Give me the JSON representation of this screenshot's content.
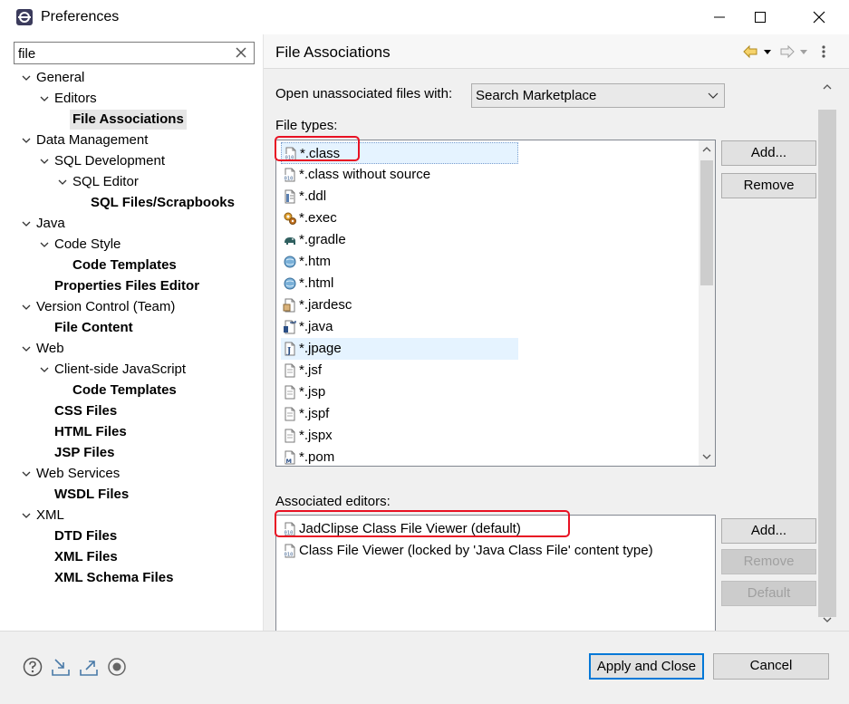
{
  "window": {
    "title": "Preferences",
    "controls": {
      "minimize": "minimize",
      "maximize": "maximize",
      "close": "close"
    }
  },
  "filter": {
    "value": "file",
    "placeholder": ""
  },
  "tree": [
    {
      "label": "General",
      "level": 0,
      "expanded": true,
      "bold": false
    },
    {
      "label": "Editors",
      "level": 1,
      "expanded": true,
      "bold": false
    },
    {
      "label": "File Associations",
      "level": 2,
      "expanded": null,
      "bold": true,
      "selected": true
    },
    {
      "label": "Data Management",
      "level": 0,
      "expanded": true,
      "bold": false
    },
    {
      "label": "SQL Development",
      "level": 1,
      "expanded": true,
      "bold": false
    },
    {
      "label": "SQL Editor",
      "level": 2,
      "expanded": true,
      "bold": false
    },
    {
      "label": "SQL Files/Scrapbooks",
      "level": 3,
      "expanded": null,
      "bold": true
    },
    {
      "label": "Java",
      "level": 0,
      "expanded": true,
      "bold": false
    },
    {
      "label": "Code Style",
      "level": 1,
      "expanded": true,
      "bold": false
    },
    {
      "label": "Code Templates",
      "level": 2,
      "expanded": null,
      "bold": true
    },
    {
      "label": "Properties Files Editor",
      "level": 1,
      "expanded": null,
      "bold": true
    },
    {
      "label": "Version Control (Team)",
      "level": 0,
      "expanded": true,
      "bold": false
    },
    {
      "label": "File Content",
      "level": 1,
      "expanded": null,
      "bold": true
    },
    {
      "label": "Web",
      "level": 0,
      "expanded": true,
      "bold": false
    },
    {
      "label": "Client-side JavaScript",
      "level": 1,
      "expanded": true,
      "bold": false
    },
    {
      "label": "Code Templates",
      "level": 2,
      "expanded": null,
      "bold": true
    },
    {
      "label": "CSS Files",
      "level": 1,
      "expanded": null,
      "bold": true
    },
    {
      "label": "HTML Files",
      "level": 1,
      "expanded": null,
      "bold": true
    },
    {
      "label": "JSP Files",
      "level": 1,
      "expanded": null,
      "bold": true
    },
    {
      "label": "Web Services",
      "level": 0,
      "expanded": true,
      "bold": false
    },
    {
      "label": "WSDL Files",
      "level": 1,
      "expanded": null,
      "bold": true
    },
    {
      "label": "XML",
      "level": 0,
      "expanded": true,
      "bold": false
    },
    {
      "label": "DTD Files",
      "level": 1,
      "expanded": null,
      "bold": true
    },
    {
      "label": "XML Files",
      "level": 1,
      "expanded": null,
      "bold": true
    },
    {
      "label": "XML Schema Files",
      "level": 1,
      "expanded": null,
      "bold": true
    }
  ],
  "page": {
    "title": "File Associations",
    "open_with_label": "Open unassociated files with:",
    "open_with_value": "Search Marketplace",
    "file_types_label": "File types:",
    "file_types": [
      {
        "label": "*.class",
        "icon": "class-file-icon",
        "selected": true
      },
      {
        "label": "*.class without source",
        "icon": "class-file-icon"
      },
      {
        "label": "*.ddl",
        "icon": "ddl-file-icon"
      },
      {
        "label": "*.exec",
        "icon": "exec-file-icon"
      },
      {
        "label": "*.gradle",
        "icon": "gradle-elephant-icon"
      },
      {
        "label": "*.htm",
        "icon": "globe-icon"
      },
      {
        "label": "*.html",
        "icon": "globe-icon"
      },
      {
        "label": "*.jardesc",
        "icon": "jardesc-file-icon"
      },
      {
        "label": "*.java",
        "icon": "java-file-icon"
      },
      {
        "label": "*.jpage",
        "icon": "jpage-file-icon",
        "hover": true
      },
      {
        "label": "*.jsf",
        "icon": "text-file-icon"
      },
      {
        "label": "*.jsp",
        "icon": "text-file-icon"
      },
      {
        "label": "*.jspf",
        "icon": "text-file-icon"
      },
      {
        "label": "*.jspx",
        "icon": "text-file-icon"
      },
      {
        "label": "*.pom",
        "icon": "pom-file-icon"
      }
    ],
    "add_type_label": "Add...",
    "remove_type_label": "Remove",
    "associated_label": "Associated editors:",
    "associated_editors": [
      {
        "label": "JadClipse Class File Viewer (default)",
        "icon": "class-file-icon"
      },
      {
        "label": "Class File Viewer (locked by 'Java Class File' content type)",
        "icon": "class-file-icon"
      }
    ],
    "add_editor_label": "Add...",
    "remove_editor_label": "Remove",
    "default_editor_label": "Default"
  },
  "footer": {
    "apply_close_label": "Apply and Close",
    "cancel_label": "Cancel"
  },
  "colors": {
    "highlight": "#e81123",
    "accent": "#0078d7",
    "selection": "#e5f3ff"
  }
}
